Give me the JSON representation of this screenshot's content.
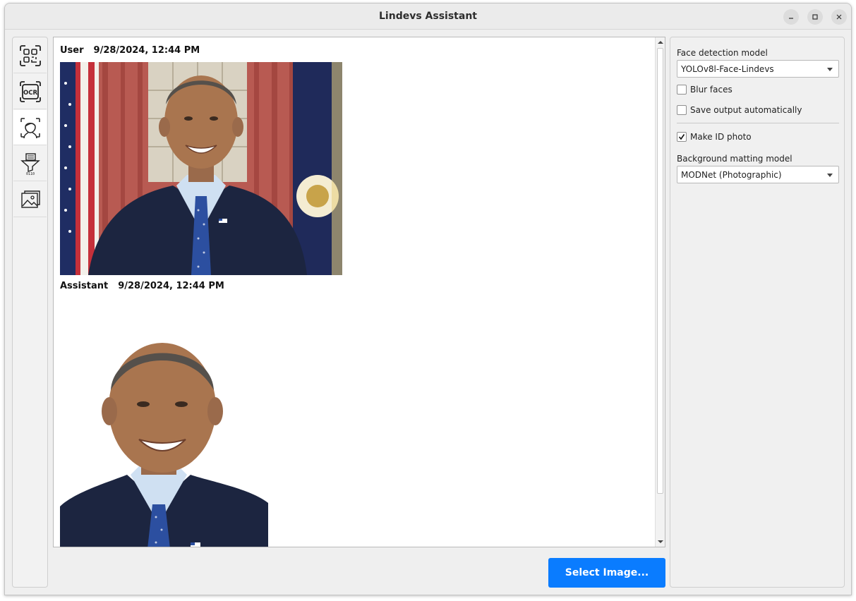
{
  "window": {
    "title": "Lindevs Assistant"
  },
  "window_controls": {
    "minimize": "minimize-icon",
    "maximize": "maximize-icon",
    "close": "close-icon"
  },
  "toolbar": {
    "items": [
      {
        "icon": "qr-scan-icon",
        "active": false
      },
      {
        "icon": "ocr-icon",
        "text": "OCR",
        "active": false
      },
      {
        "icon": "face-detection-icon",
        "active": true
      },
      {
        "icon": "document-filter-icon",
        "text": "0110",
        "active": false
      },
      {
        "icon": "image-gallery-icon",
        "active": false
      }
    ]
  },
  "chat": {
    "messages": [
      {
        "author": "User",
        "timestamp": "9/28/2024, 12:44 PM",
        "content": "original-portrait-photo"
      },
      {
        "author": "Assistant",
        "timestamp": "9/28/2024, 12:44 PM",
        "content": "id-photo-white-background"
      }
    ]
  },
  "actions": {
    "select_image": "Select Image..."
  },
  "settings": {
    "face_detection_model": {
      "label": "Face detection model",
      "value": "YOLOv8l-Face-Lindevs"
    },
    "blur_faces": {
      "label": "Blur faces",
      "checked": false
    },
    "save_output": {
      "label": "Save output automatically",
      "checked": false
    },
    "make_id_photo": {
      "label": "Make ID photo",
      "checked": true
    },
    "background_matting_model": {
      "label": "Background matting model",
      "value": "MODNet (Photographic)"
    }
  },
  "colors": {
    "accent": "#0a7cff",
    "panel_bg": "#efefef"
  }
}
